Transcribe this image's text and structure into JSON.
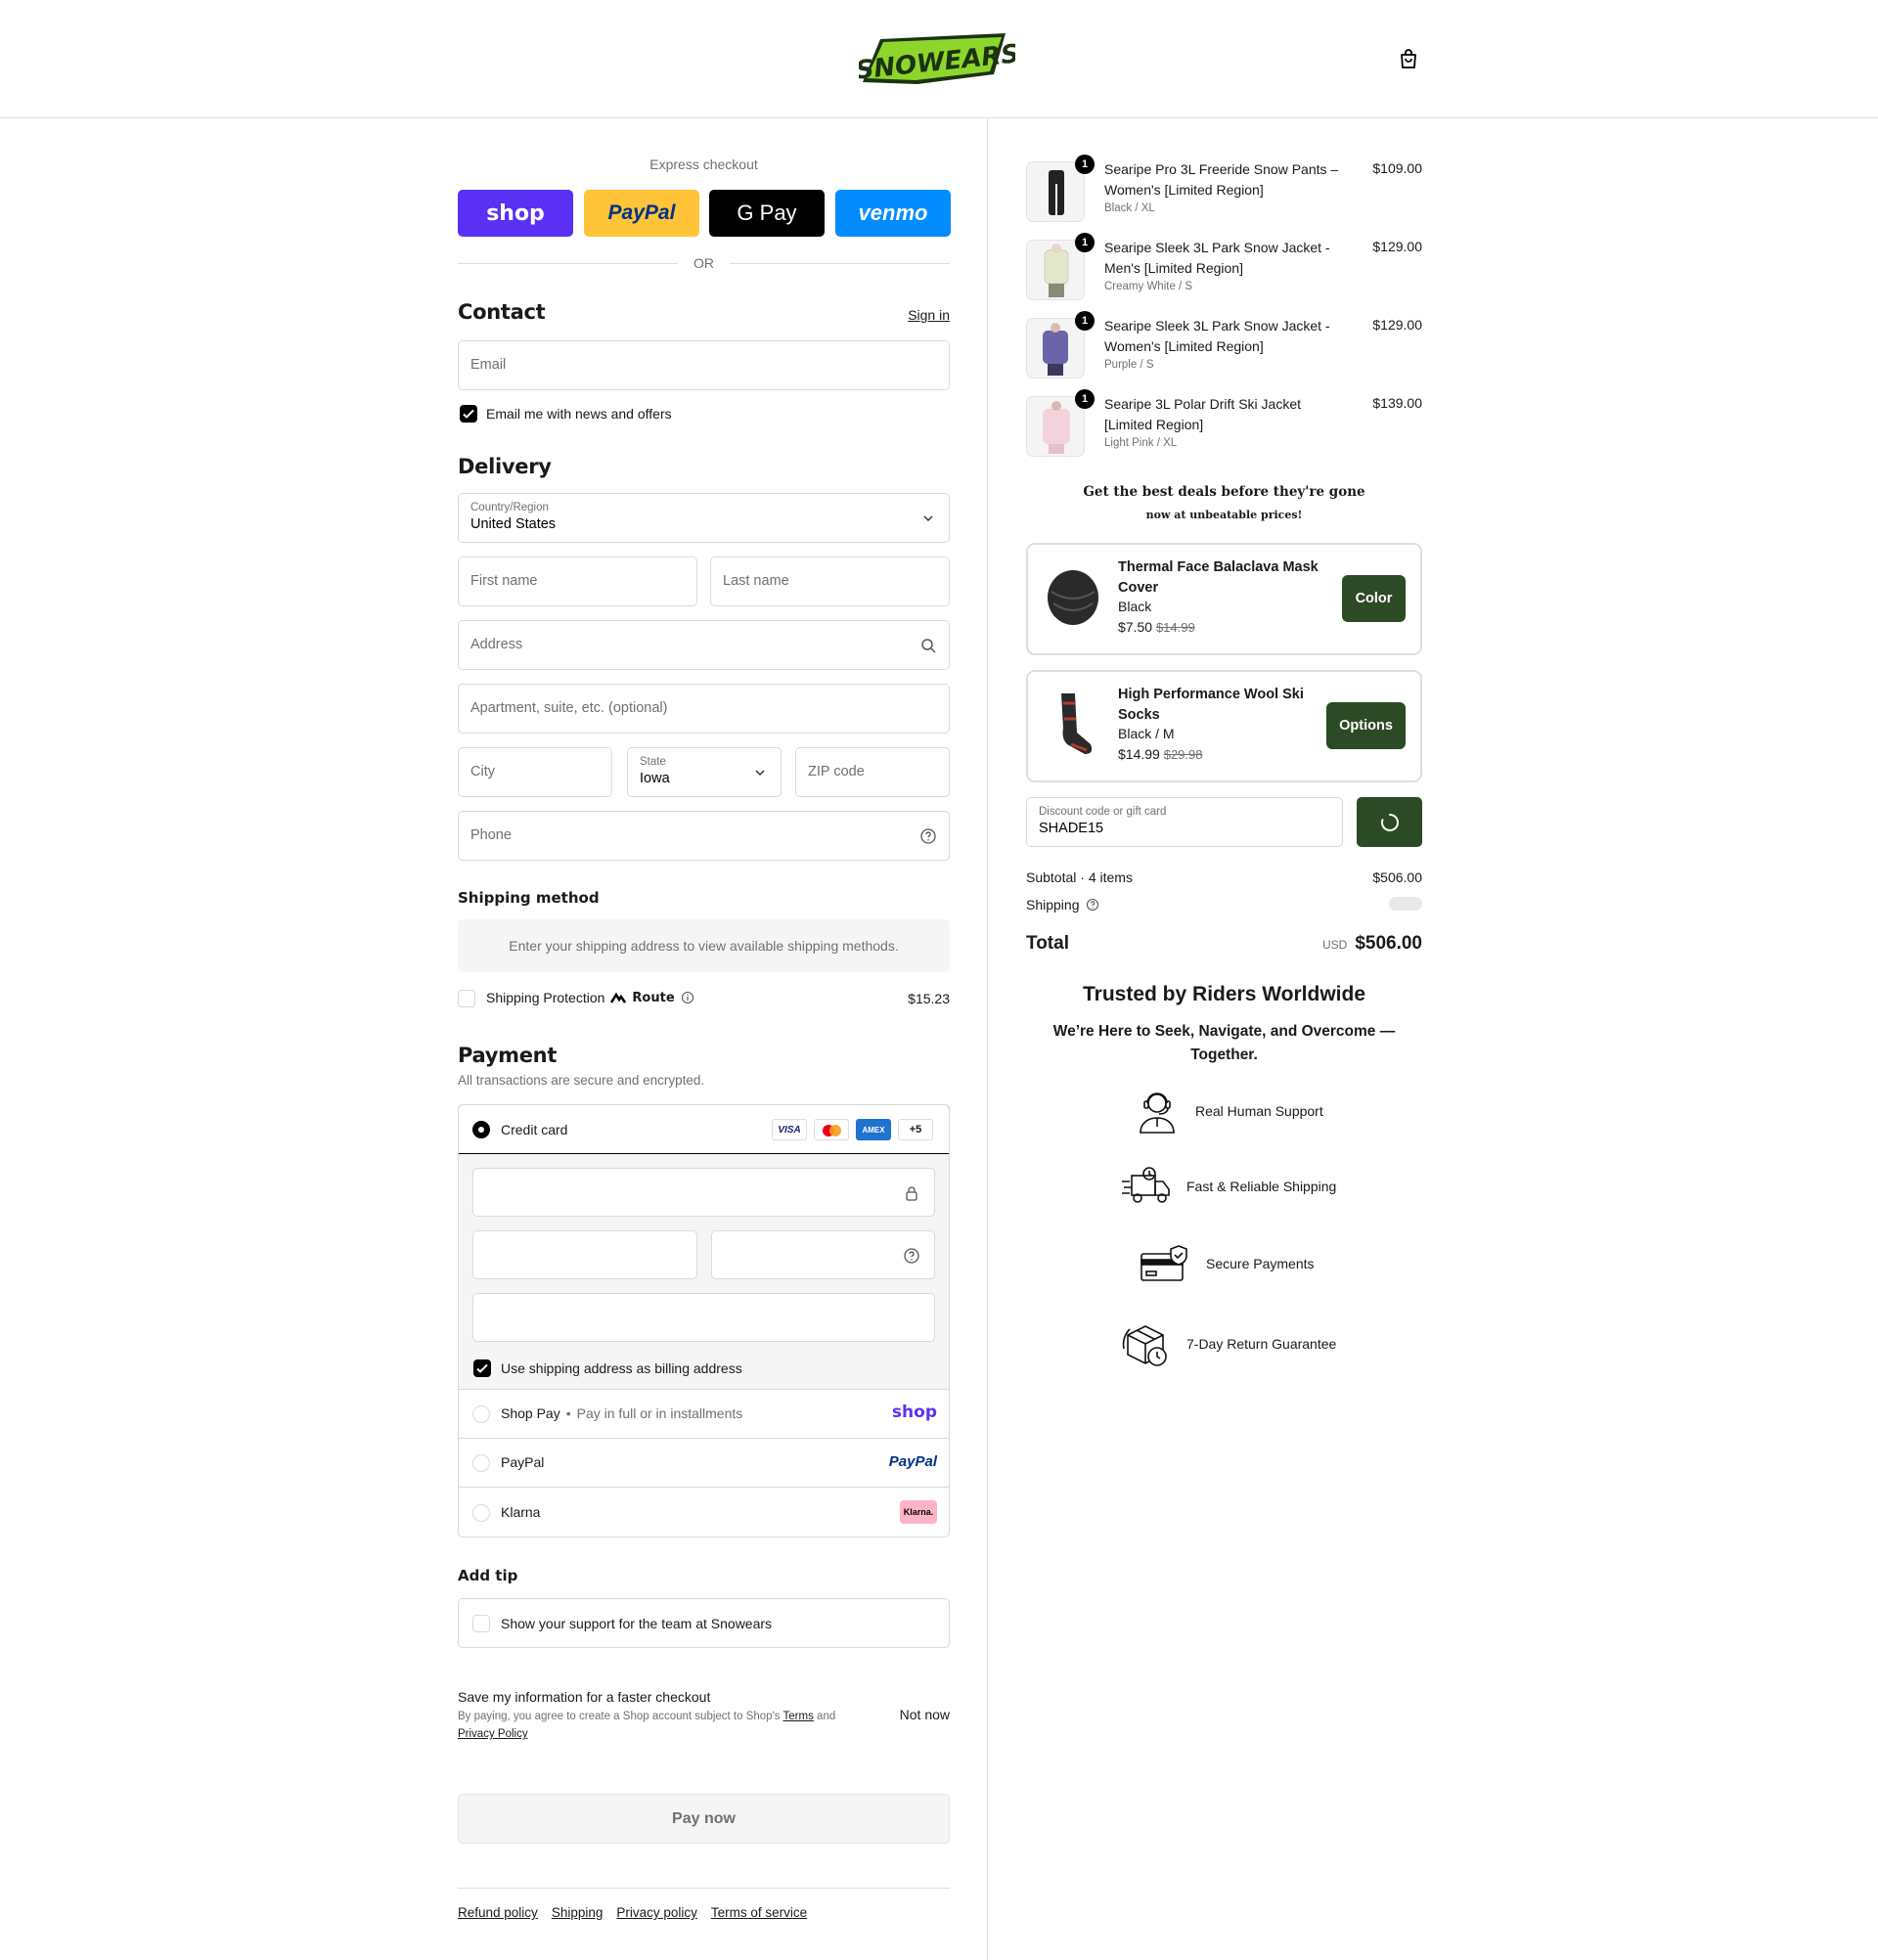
{
  "header": {
    "logo_text": "SNOWEARS",
    "cart_icon": "shopping-bag-icon"
  },
  "express": {
    "title": "Express checkout",
    "buttons": [
      {
        "label": "shop",
        "bg": "#5a31f4",
        "color": "#ffffff"
      },
      {
        "label": "PayPal",
        "bg": "#ffc439",
        "color": "#003087"
      },
      {
        "label": "G Pay",
        "bg": "#000000",
        "color": "#ffffff"
      },
      {
        "label": "venmo",
        "bg": "#008cff",
        "color": "#ffffff"
      }
    ],
    "or": "OR"
  },
  "contact": {
    "title": "Contact",
    "sign_in": "Sign in",
    "email_placeholder": "Email",
    "news_label": "Email me with news and offers"
  },
  "delivery": {
    "title": "Delivery",
    "country_label": "Country/Region",
    "country_value": "United States",
    "first_name": "First name",
    "last_name": "Last name",
    "address": "Address",
    "apartment": "Apartment, suite, etc. (optional)",
    "city": "City",
    "state_label": "State",
    "state_value": "Iowa",
    "zip": "ZIP code",
    "phone": "Phone"
  },
  "shipping": {
    "title": "Shipping method",
    "notice": "Enter your shipping address to view available shipping methods.",
    "protection_label": "Shipping Protection",
    "protection_brand": "Route",
    "protection_price": "$15.23"
  },
  "payment": {
    "title": "Payment",
    "subtitle": "All transactions are secure and encrypted.",
    "credit_card": "Credit card",
    "card_brands": [
      "VISA",
      "MC",
      "AMEX",
      "+5"
    ],
    "billing_label": "Use shipping address as billing address",
    "shop_pay": "Shop Pay",
    "shop_pay_sub": "Pay in full or in installments",
    "shop_pay_logo": "shop",
    "paypal": "PayPal",
    "paypal_logo": "PayPal",
    "klarna": "Klarna",
    "klarna_logo": "Klarna."
  },
  "tip": {
    "title": "Add tip",
    "label": "Show your support for the team at Snowears"
  },
  "save": {
    "title": "Save my information for a faster checkout",
    "legal_prefix": "By paying, you agree to create a Shop account subject to Shop's",
    "terms": "Terms",
    "and": "and",
    "privacy": "Privacy Policy",
    "not_now": "Not now"
  },
  "pay_now": "Pay now",
  "footer_links": [
    "Refund policy",
    "Shipping",
    "Privacy policy",
    "Terms of service"
  ],
  "order": {
    "items": [
      {
        "qty": "1",
        "name": "Searipe Pro 3L Freeride Snow Pants – Women's [Limited Region]",
        "variant": "Black / XL",
        "price": "$109.00",
        "color": "#222222"
      },
      {
        "qty": "1",
        "name": "Searipe Sleek 3L Park Snow Jacket - Men's [Limited Region]",
        "variant": "Creamy White / S",
        "price": "$129.00",
        "color": "#e8ecd8"
      },
      {
        "qty": "1",
        "name": "Searipe Sleek 3L Park Snow Jacket - Women's [Limited Region]",
        "variant": "Purple / S",
        "price": "$129.00",
        "color": "#6c64a8"
      },
      {
        "qty": "1",
        "name": "Searipe 3L Polar Drift Ski Jacket [Limited Region]",
        "variant": "Light Pink / XL",
        "price": "$139.00",
        "color": "#f2d2dc"
      }
    ],
    "deals_title": "Get the best deals before they're gone",
    "deals_sub": "now at unbeatable prices!",
    "upsells": [
      {
        "title": "Thermal Face Balaclava Mask Cover",
        "variant": "Black",
        "price": "$7.50",
        "compare": "$14.99",
        "button": "Color"
      },
      {
        "title": "High Performance Wool Ski Socks",
        "variant": "Black / M",
        "price": "$14.99",
        "compare": "$29.98",
        "button": "Options"
      }
    ],
    "discount_label": "Discount code or gift card",
    "discount_value": "SHADE15",
    "subtotal_label": "Subtotal · 4 items",
    "subtotal_value": "$506.00",
    "shipping_label": "Shipping",
    "total_label": "Total",
    "currency": "USD",
    "total_value": "$506.00"
  },
  "trust": {
    "title": "Trusted by Riders Worldwide",
    "subtitle": "We’re Here to Seek, Navigate, and Overcome — Together.",
    "items": [
      {
        "label": "Real Human Support",
        "icon": "headset-agent-icon"
      },
      {
        "label": "Fast & Reliable Shipping",
        "icon": "delivery-truck-icon"
      },
      {
        "label": "Secure Payments",
        "icon": "secure-card-icon"
      },
      {
        "label": "7-Day Return Guarantee",
        "icon": "return-box-icon"
      }
    ]
  }
}
